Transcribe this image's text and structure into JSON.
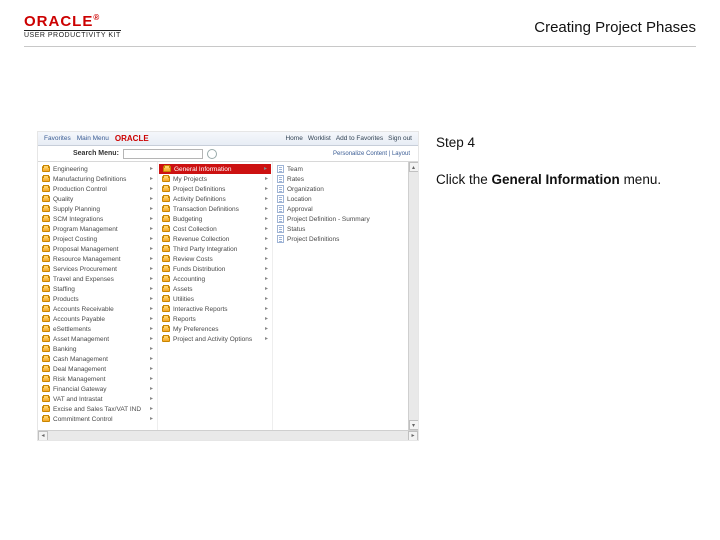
{
  "header": {
    "brand": "ORACLE",
    "brand_sub": "USER PRODUCTIVITY KIT",
    "title": "Creating Project Phases"
  },
  "instructions": {
    "step": "Step 4",
    "line1_pre": "Click the ",
    "line1_bold": "General Information",
    "line1_post": " menu."
  },
  "shot": {
    "menu": {
      "favorites": "Favorites",
      "main": "Main Menu"
    },
    "links": {
      "home": "Home",
      "worklist": "Worklist",
      "add": "Add to Favorites",
      "signout": "Sign out"
    },
    "search_label": "Search Menu:",
    "search_placeholder": "",
    "personalize": "Personalize Content | Layout",
    "col1": [
      "Engineering",
      "Manufacturing Definitions",
      "Production Control",
      "Quality",
      "Supply Planning",
      "SCM Integrations",
      "Program Management",
      "Project Costing",
      "Proposal Management",
      "Resource Management",
      "Services Procurement",
      "Travel and Expenses",
      "Staffing",
      "Products",
      "Accounts Receivable",
      "Accounts Payable",
      "eSettlements",
      "Asset Management",
      "Banking",
      "Cash Management",
      "Deal Management",
      "Risk Management",
      "Financial Gateway",
      "VAT and Intrastat",
      "Excise and Sales Tax/VAT IND",
      "Commitment Control"
    ],
    "col2": [
      "My Projects",
      "Project Definitions",
      "Activity Definitions",
      "Transaction Definitions",
      "Budgeting",
      "Cost Collection",
      "Revenue Collection",
      "Third Party Integration",
      "Review Costs",
      "Funds Distribution",
      "Accounting",
      "Assets",
      "Utilities",
      "Interactive Reports",
      "Reports",
      "My Preferences",
      "Project and Activity Options"
    ],
    "highlight": "General Information",
    "col3": [
      "Team",
      "Rates",
      "Organization",
      "Location",
      "Approval",
      "Project Definition - Summary",
      "Status",
      "Project Definitions"
    ]
  }
}
